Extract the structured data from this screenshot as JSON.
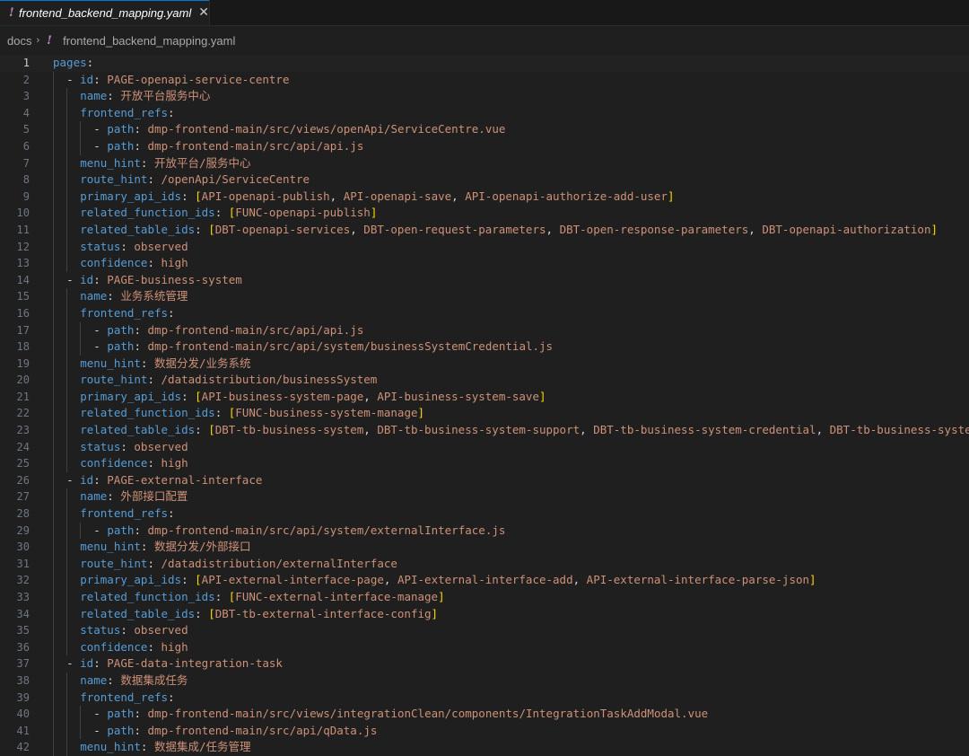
{
  "tab": {
    "label": "frontend_backend_mapping.yaml",
    "close_glyph": "✕",
    "icon": "yaml-bang-icon"
  },
  "breadcrumb": {
    "folder": "docs",
    "separator": "›",
    "file": "frontend_backend_mapping.yaml"
  },
  "colors": {
    "key": "#569cd6",
    "string": "#ce9178",
    "bracket": "#ffd700",
    "line_number": "#6e7681"
  },
  "current_line": 1,
  "lines": [
    {
      "n": "1",
      "indent": 0,
      "t": [
        {
          "c": "k",
          "v": "pages"
        },
        {
          "c": "p",
          "v": ":"
        }
      ]
    },
    {
      "n": "2",
      "indent": 2,
      "t": [
        {
          "c": "p",
          "v": "- "
        },
        {
          "c": "k",
          "v": "id"
        },
        {
          "c": "p",
          "v": ": "
        },
        {
          "c": "s",
          "v": "PAGE-openapi-service-centre"
        }
      ]
    },
    {
      "n": "3",
      "indent": 4,
      "t": [
        {
          "c": "k",
          "v": "name"
        },
        {
          "c": "p",
          "v": ": "
        },
        {
          "c": "s",
          "v": "开放平台服务中心"
        }
      ]
    },
    {
      "n": "4",
      "indent": 4,
      "t": [
        {
          "c": "k",
          "v": "frontend_refs"
        },
        {
          "c": "p",
          "v": ":"
        }
      ]
    },
    {
      "n": "5",
      "indent": 6,
      "t": [
        {
          "c": "p",
          "v": "- "
        },
        {
          "c": "k",
          "v": "path"
        },
        {
          "c": "p",
          "v": ": "
        },
        {
          "c": "s",
          "v": "dmp-frontend-main/src/views/openApi/ServiceCentre.vue"
        }
      ]
    },
    {
      "n": "6",
      "indent": 6,
      "t": [
        {
          "c": "p",
          "v": "- "
        },
        {
          "c": "k",
          "v": "path"
        },
        {
          "c": "p",
          "v": ": "
        },
        {
          "c": "s",
          "v": "dmp-frontend-main/src/api/api.js"
        }
      ]
    },
    {
      "n": "7",
      "indent": 4,
      "t": [
        {
          "c": "k",
          "v": "menu_hint"
        },
        {
          "c": "p",
          "v": ": "
        },
        {
          "c": "s",
          "v": "开放平台/服务中心"
        }
      ]
    },
    {
      "n": "8",
      "indent": 4,
      "t": [
        {
          "c": "k",
          "v": "route_hint"
        },
        {
          "c": "p",
          "v": ": "
        },
        {
          "c": "s",
          "v": "/openApi/ServiceCentre"
        }
      ]
    },
    {
      "n": "9",
      "indent": 4,
      "t": [
        {
          "c": "k",
          "v": "primary_api_ids"
        },
        {
          "c": "p",
          "v": ": "
        },
        {
          "c": "b",
          "v": "["
        },
        {
          "c": "s",
          "v": "API-openapi-publish"
        },
        {
          "c": "p",
          "v": ", "
        },
        {
          "c": "s",
          "v": "API-openapi-save"
        },
        {
          "c": "p",
          "v": ", "
        },
        {
          "c": "s",
          "v": "API-openapi-authorize-add-user"
        },
        {
          "c": "b",
          "v": "]"
        }
      ]
    },
    {
      "n": "10",
      "indent": 4,
      "t": [
        {
          "c": "k",
          "v": "related_function_ids"
        },
        {
          "c": "p",
          "v": ": "
        },
        {
          "c": "b",
          "v": "["
        },
        {
          "c": "s",
          "v": "FUNC-openapi-publish"
        },
        {
          "c": "b",
          "v": "]"
        }
      ]
    },
    {
      "n": "11",
      "indent": 4,
      "t": [
        {
          "c": "k",
          "v": "related_table_ids"
        },
        {
          "c": "p",
          "v": ": "
        },
        {
          "c": "b",
          "v": "["
        },
        {
          "c": "s",
          "v": "DBT-openapi-services"
        },
        {
          "c": "p",
          "v": ", "
        },
        {
          "c": "s",
          "v": "DBT-open-request-parameters"
        },
        {
          "c": "p",
          "v": ", "
        },
        {
          "c": "s",
          "v": "DBT-open-response-parameters"
        },
        {
          "c": "p",
          "v": ", "
        },
        {
          "c": "s",
          "v": "DBT-openapi-authorization"
        },
        {
          "c": "b",
          "v": "]"
        }
      ]
    },
    {
      "n": "12",
      "indent": 4,
      "t": [
        {
          "c": "k",
          "v": "status"
        },
        {
          "c": "p",
          "v": ": "
        },
        {
          "c": "s",
          "v": "observed"
        }
      ]
    },
    {
      "n": "13",
      "indent": 4,
      "t": [
        {
          "c": "k",
          "v": "confidence"
        },
        {
          "c": "p",
          "v": ": "
        },
        {
          "c": "s",
          "v": "high"
        }
      ]
    },
    {
      "n": "14",
      "indent": 2,
      "t": [
        {
          "c": "p",
          "v": "- "
        },
        {
          "c": "k",
          "v": "id"
        },
        {
          "c": "p",
          "v": ": "
        },
        {
          "c": "s",
          "v": "PAGE-business-system"
        }
      ]
    },
    {
      "n": "15",
      "indent": 4,
      "t": [
        {
          "c": "k",
          "v": "name"
        },
        {
          "c": "p",
          "v": ": "
        },
        {
          "c": "s",
          "v": "业务系统管理"
        }
      ]
    },
    {
      "n": "16",
      "indent": 4,
      "t": [
        {
          "c": "k",
          "v": "frontend_refs"
        },
        {
          "c": "p",
          "v": ":"
        }
      ]
    },
    {
      "n": "17",
      "indent": 6,
      "t": [
        {
          "c": "p",
          "v": "- "
        },
        {
          "c": "k",
          "v": "path"
        },
        {
          "c": "p",
          "v": ": "
        },
        {
          "c": "s",
          "v": "dmp-frontend-main/src/api/api.js"
        }
      ]
    },
    {
      "n": "18",
      "indent": 6,
      "t": [
        {
          "c": "p",
          "v": "- "
        },
        {
          "c": "k",
          "v": "path"
        },
        {
          "c": "p",
          "v": ": "
        },
        {
          "c": "s",
          "v": "dmp-frontend-main/src/api/system/businessSystemCredential.js"
        }
      ]
    },
    {
      "n": "19",
      "indent": 4,
      "t": [
        {
          "c": "k",
          "v": "menu_hint"
        },
        {
          "c": "p",
          "v": ": "
        },
        {
          "c": "s",
          "v": "数据分发/业务系统"
        }
      ]
    },
    {
      "n": "20",
      "indent": 4,
      "t": [
        {
          "c": "k",
          "v": "route_hint"
        },
        {
          "c": "p",
          "v": ": "
        },
        {
          "c": "s",
          "v": "/datadistribution/businessSystem"
        }
      ]
    },
    {
      "n": "21",
      "indent": 4,
      "t": [
        {
          "c": "k",
          "v": "primary_api_ids"
        },
        {
          "c": "p",
          "v": ": "
        },
        {
          "c": "b",
          "v": "["
        },
        {
          "c": "s",
          "v": "API-business-system-page"
        },
        {
          "c": "p",
          "v": ", "
        },
        {
          "c": "s",
          "v": "API-business-system-save"
        },
        {
          "c": "b",
          "v": "]"
        }
      ]
    },
    {
      "n": "22",
      "indent": 4,
      "t": [
        {
          "c": "k",
          "v": "related_function_ids"
        },
        {
          "c": "p",
          "v": ": "
        },
        {
          "c": "b",
          "v": "["
        },
        {
          "c": "s",
          "v": "FUNC-business-system-manage"
        },
        {
          "c": "b",
          "v": "]"
        }
      ]
    },
    {
      "n": "23",
      "indent": 4,
      "t": [
        {
          "c": "k",
          "v": "related_table_ids"
        },
        {
          "c": "p",
          "v": ": "
        },
        {
          "c": "b",
          "v": "["
        },
        {
          "c": "s",
          "v": "DBT-tb-business-system"
        },
        {
          "c": "p",
          "v": ", "
        },
        {
          "c": "s",
          "v": "DBT-tb-business-system-support"
        },
        {
          "c": "p",
          "v": ", "
        },
        {
          "c": "s",
          "v": "DBT-tb-business-system-credential"
        },
        {
          "c": "p",
          "v": ", "
        },
        {
          "c": "s",
          "v": "DBT-tb-business-syste"
        }
      ]
    },
    {
      "n": "24",
      "indent": 4,
      "t": [
        {
          "c": "k",
          "v": "status"
        },
        {
          "c": "p",
          "v": ": "
        },
        {
          "c": "s",
          "v": "observed"
        }
      ]
    },
    {
      "n": "25",
      "indent": 4,
      "t": [
        {
          "c": "k",
          "v": "confidence"
        },
        {
          "c": "p",
          "v": ": "
        },
        {
          "c": "s",
          "v": "high"
        }
      ]
    },
    {
      "n": "26",
      "indent": 2,
      "t": [
        {
          "c": "p",
          "v": "- "
        },
        {
          "c": "k",
          "v": "id"
        },
        {
          "c": "p",
          "v": ": "
        },
        {
          "c": "s",
          "v": "PAGE-external-interface"
        }
      ]
    },
    {
      "n": "27",
      "indent": 4,
      "t": [
        {
          "c": "k",
          "v": "name"
        },
        {
          "c": "p",
          "v": ": "
        },
        {
          "c": "s",
          "v": "外部接口配置"
        }
      ]
    },
    {
      "n": "28",
      "indent": 4,
      "t": [
        {
          "c": "k",
          "v": "frontend_refs"
        },
        {
          "c": "p",
          "v": ":"
        }
      ]
    },
    {
      "n": "29",
      "indent": 6,
      "t": [
        {
          "c": "p",
          "v": "- "
        },
        {
          "c": "k",
          "v": "path"
        },
        {
          "c": "p",
          "v": ": "
        },
        {
          "c": "s",
          "v": "dmp-frontend-main/src/api/system/externalInterface.js"
        }
      ]
    },
    {
      "n": "30",
      "indent": 4,
      "t": [
        {
          "c": "k",
          "v": "menu_hint"
        },
        {
          "c": "p",
          "v": ": "
        },
        {
          "c": "s",
          "v": "数据分发/外部接口"
        }
      ]
    },
    {
      "n": "31",
      "indent": 4,
      "t": [
        {
          "c": "k",
          "v": "route_hint"
        },
        {
          "c": "p",
          "v": ": "
        },
        {
          "c": "s",
          "v": "/datadistribution/externalInterface"
        }
      ]
    },
    {
      "n": "32",
      "indent": 4,
      "t": [
        {
          "c": "k",
          "v": "primary_api_ids"
        },
        {
          "c": "p",
          "v": ": "
        },
        {
          "c": "b",
          "v": "["
        },
        {
          "c": "s",
          "v": "API-external-interface-page"
        },
        {
          "c": "p",
          "v": ", "
        },
        {
          "c": "s",
          "v": "API-external-interface-add"
        },
        {
          "c": "p",
          "v": ", "
        },
        {
          "c": "s",
          "v": "API-external-interface-parse-json"
        },
        {
          "c": "b",
          "v": "]"
        }
      ]
    },
    {
      "n": "33",
      "indent": 4,
      "t": [
        {
          "c": "k",
          "v": "related_function_ids"
        },
        {
          "c": "p",
          "v": ": "
        },
        {
          "c": "b",
          "v": "["
        },
        {
          "c": "s",
          "v": "FUNC-external-interface-manage"
        },
        {
          "c": "b",
          "v": "]"
        }
      ]
    },
    {
      "n": "34",
      "indent": 4,
      "t": [
        {
          "c": "k",
          "v": "related_table_ids"
        },
        {
          "c": "p",
          "v": ": "
        },
        {
          "c": "b",
          "v": "["
        },
        {
          "c": "s",
          "v": "DBT-tb-external-interface-config"
        },
        {
          "c": "b",
          "v": "]"
        }
      ]
    },
    {
      "n": "35",
      "indent": 4,
      "t": [
        {
          "c": "k",
          "v": "status"
        },
        {
          "c": "p",
          "v": ": "
        },
        {
          "c": "s",
          "v": "observed"
        }
      ]
    },
    {
      "n": "36",
      "indent": 4,
      "t": [
        {
          "c": "k",
          "v": "confidence"
        },
        {
          "c": "p",
          "v": ": "
        },
        {
          "c": "s",
          "v": "high"
        }
      ]
    },
    {
      "n": "37",
      "indent": 2,
      "t": [
        {
          "c": "p",
          "v": "- "
        },
        {
          "c": "k",
          "v": "id"
        },
        {
          "c": "p",
          "v": ": "
        },
        {
          "c": "s",
          "v": "PAGE-data-integration-task"
        }
      ]
    },
    {
      "n": "38",
      "indent": 4,
      "t": [
        {
          "c": "k",
          "v": "name"
        },
        {
          "c": "p",
          "v": ": "
        },
        {
          "c": "s",
          "v": "数据集成任务"
        }
      ]
    },
    {
      "n": "39",
      "indent": 4,
      "t": [
        {
          "c": "k",
          "v": "frontend_refs"
        },
        {
          "c": "p",
          "v": ":"
        }
      ]
    },
    {
      "n": "40",
      "indent": 6,
      "t": [
        {
          "c": "p",
          "v": "- "
        },
        {
          "c": "k",
          "v": "path"
        },
        {
          "c": "p",
          "v": ": "
        },
        {
          "c": "s",
          "v": "dmp-frontend-main/src/views/integrationClean/components/IntegrationTaskAddModal.vue"
        }
      ]
    },
    {
      "n": "41",
      "indent": 6,
      "t": [
        {
          "c": "p",
          "v": "- "
        },
        {
          "c": "k",
          "v": "path"
        },
        {
          "c": "p",
          "v": ": "
        },
        {
          "c": "s",
          "v": "dmp-frontend-main/src/api/qData.js"
        }
      ]
    },
    {
      "n": "42",
      "indent": 4,
      "t": [
        {
          "c": "k",
          "v": "menu_hint"
        },
        {
          "c": "p",
          "v": ": "
        },
        {
          "c": "s",
          "v": "数据集成/任务管理"
        }
      ]
    }
  ]
}
